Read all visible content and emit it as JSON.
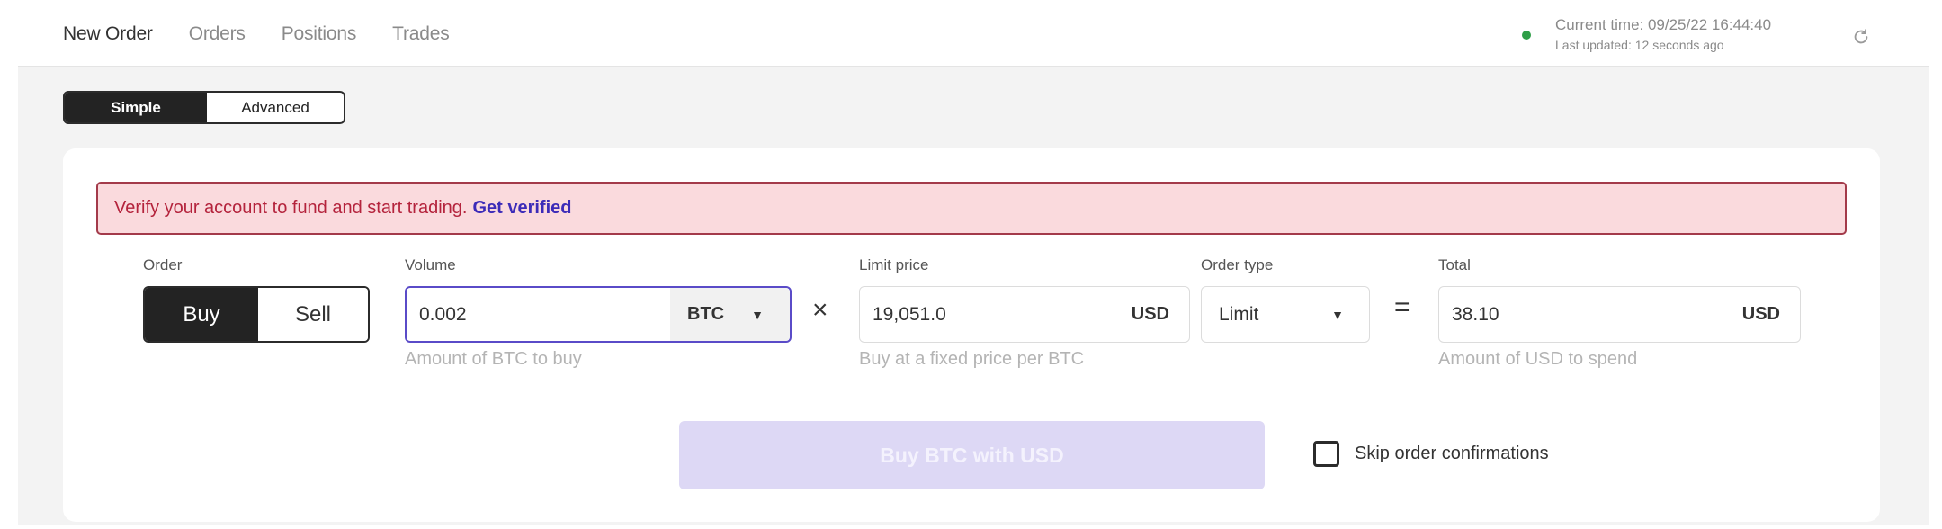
{
  "tabs": [
    {
      "label": "New Order",
      "active": true
    },
    {
      "label": "Orders",
      "active": false
    },
    {
      "label": "Positions",
      "active": false
    },
    {
      "label": "Trades",
      "active": false
    }
  ],
  "status": {
    "connection_color": "#2e9e47",
    "current_time": "Current time: 09/25/22 16:44:40",
    "last_updated": "Last updated: 12 seconds ago",
    "refresh_icon": "refresh-icon"
  },
  "mode_toggle": {
    "simple_label": "Simple",
    "advanced_label": "Advanced",
    "selected": "Simple"
  },
  "alert": {
    "text": "Verify your account to fund and start trading.",
    "link_label": "Get verified",
    "text_color": "#b4233c",
    "link_color": "#3c2bb8"
  },
  "order": {
    "label": "Order",
    "buy_label": "Buy",
    "sell_label": "Sell",
    "selected": "Buy"
  },
  "volume": {
    "label": "Volume",
    "value": "0.002",
    "currency": "BTC",
    "helper": "Amount of BTC to buy"
  },
  "operators": {
    "multiply": "×",
    "equals": "="
  },
  "limit_price": {
    "label": "Limit price",
    "value": "19,051.0",
    "unit": "USD",
    "helper": "Buy at a fixed price per BTC"
  },
  "order_type": {
    "label": "Order type",
    "value": "Limit"
  },
  "total": {
    "label": "Total",
    "value": "38.10",
    "unit": "USD",
    "helper": "Amount of USD to spend"
  },
  "submit": {
    "label": "Buy BTC with USD",
    "disabled": true
  },
  "skip_confirmations": {
    "label": "Skip order confirmations",
    "checked": false
  }
}
